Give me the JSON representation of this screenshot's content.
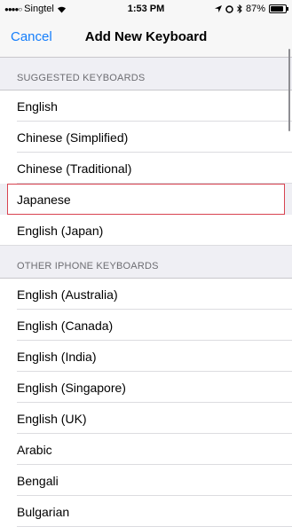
{
  "status": {
    "carrier": "Singtel",
    "time": "1:53 PM",
    "battery": "87%",
    "battery_level": 0.87
  },
  "nav": {
    "cancel": "Cancel",
    "title": "Add New Keyboard"
  },
  "suggested": {
    "header": "SUGGESTED KEYBOARDS",
    "items": [
      "English",
      "Chinese (Simplified)",
      "Chinese (Traditional)",
      "Japanese",
      "English (Japan)"
    ]
  },
  "other": {
    "header": "OTHER IPHONE KEYBOARDS",
    "items": [
      "English (Australia)",
      "English (Canada)",
      "English (India)",
      "English (Singapore)",
      "English (UK)",
      "Arabic",
      "Bengali",
      "Bulgarian"
    ]
  },
  "icons": [
    "wifi-icon",
    "location-arrow-icon",
    "alarm-icon",
    "bluetooth-icon",
    "battery-icon"
  ]
}
